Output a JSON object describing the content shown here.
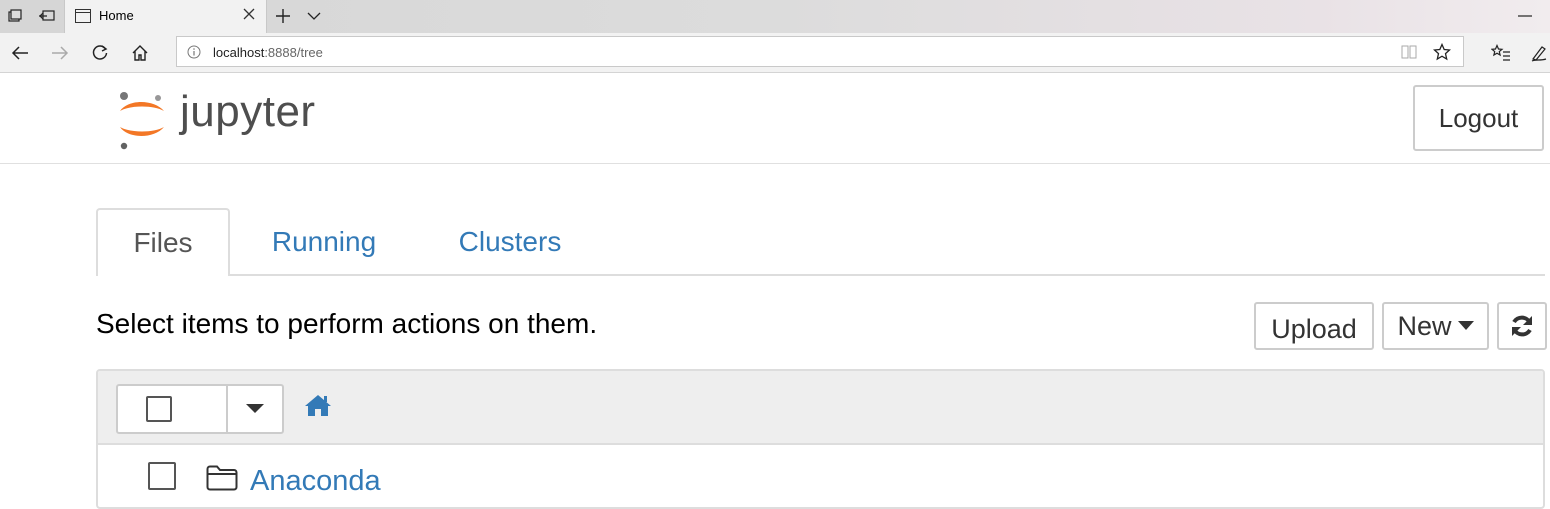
{
  "browser": {
    "tab_title": "Home",
    "url_host": "localhost",
    "url_rest": ":8888/tree"
  },
  "header": {
    "logo_text": "jupyter",
    "logout_label": "Logout"
  },
  "tabs": [
    {
      "label": "Files",
      "active": true
    },
    {
      "label": "Running",
      "active": false
    },
    {
      "label": "Clusters",
      "active": false
    }
  ],
  "toolbar": {
    "instruction": "Select items to perform actions on them.",
    "upload_label": "Upload",
    "new_label": "New"
  },
  "files": [
    {
      "name": "Anaconda",
      "type": "folder"
    }
  ],
  "colors": {
    "link": "#337ab7",
    "logo_orange": "#f37726",
    "logo_gray": "#767677"
  }
}
